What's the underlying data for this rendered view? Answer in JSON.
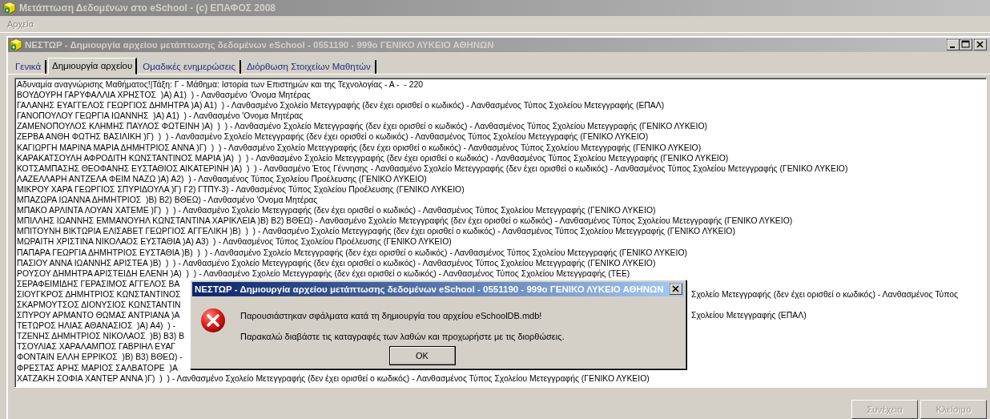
{
  "app": {
    "title": "Μετάπτωση Δεδομένων στο eSchool - (c) ΕΠΑΦΟΣ 2008",
    "menu": [
      {
        "label": "Αρχεία",
        "disabled": true
      }
    ]
  },
  "window": {
    "title": "ΝΕΣΤΩΡ - Δημιουργία αρχείου μετάπτωσης δεδομένων eSchool - 0551190 - 999ο ΓΕΝΙΚΟ ΛΥΚΕΙΟ ΑΘΗΝΩΝ"
  },
  "tabs": [
    {
      "label": "Γενικά",
      "selected": false
    },
    {
      "label": "Δημιουργία αρχείου",
      "selected": true
    },
    {
      "label": "Ομαδικές ενημερώσεις",
      "selected": false
    },
    {
      "label": "Διόρθωση Στοιχείων Μαθητών",
      "selected": false
    }
  ],
  "log": [
    {
      "text": "Αδυναμία αναγνώρισης Μαθήματος!|Τάξη: Γ - Μάθημα: Ιστορία των Επιστημών και της Τεχνολογίας - Α -  - 220"
    },
    {
      "text": "ΒΟΥΔΟΥΡΗ ΓΑΡΥΦΑΛΛΙΑ ΧΡΗΣΤΟΣ  )Α) Α1)  ) - Λανθασμένο 'Ονομα Μητέρας"
    },
    {
      "text": "ΓΑΛΑΝΗΣ ΕΥΑΓΓΕΛΟΣ ΓΕΩΡΓΙΟΣ ΔΗΜΗΤΡΑ )Α) Α1)  ) - Λανθασμένο Σχολείο Μετεγγραφής (δεν έχει ορισθεί ο κωδικός) - Λανθασμένος Τύπος Σχολείου Μετεγγραφής (ΕΠΑΛ)"
    },
    {
      "text": "ΓΑΝΟΠΟΥΛΟΥ ΓΕΩΡΓΙΑ ΙΩΑΝΝΗΣ  )Α) Α1)  ) - Λανθασμένο 'Ονομα Μητέρας"
    },
    {
      "text": "ΖΑΜΕΝΟΠΟΥΛΟΣ ΚΛΗΜΗΣ ΠΑΥΛΟΣ ΦΩΤΕΙΝΗ )Α)  )  ) - Λανθασμένο Σχολείο Μετεγγραφής (δεν έχει ορισθεί ο κωδικός) - Λανθασμένος Τύπος Σχολείου Μετεγγραφής (ΓΕΝΙΚΟ ΛΥΚΕΙΟ)"
    },
    {
      "text": "ΖΕΡΒΑ ΑΝΘΗ ΦΩΤΗΣ ΒΑΣΙΛΙΚΗ )Γ)  )  ) - Λανθασμένο Σχολείο Μετεγγραφής (δεν έχει ορισθεί ο κωδικός) - Λανθασμένος Τύπος Σχολείου Μετεγγραφής (ΓΕΝΙΚΟ ΛΥΚΕΙΟ)"
    },
    {
      "text": "ΚΑΓΙΩΡΓΗ ΜΑΡΙΝΑ ΜΑΡΙΑ ΔΗΜΗΤΡΙΟΣ ΑΝΝΑ )Γ)  )  ) - Λανθασμένο Σχολείο Μετεγγραφής (δεν έχει ορισθεί ο κωδικός) - Λανθασμένος Τύπος Σχολείου Μετεγγραφής (ΓΕΝΙΚΟ ΛΥΚΕΙΟ)"
    },
    {
      "text": "ΚΑΡΑΚΑΤΣΟΥΛΗ ΑΦΡΟΔΙΤΗ ΚΩΝΣΤΑΝΤΙΝΟΣ ΜΑΡΙΑ )Α)  )  ) - Λανθασμένο Σχολείο Μετεγγραφής (δεν έχει ορισθεί ο κωδικός) - Λανθασμένος Τύπος Σχολείου Μετεγγραφής (ΓΕΝΙΚΟ ΛΥΚΕΙΟ)"
    },
    {
      "text": "ΚΟΤΣΑΜΠΑΣΗΣ ΘΕΟΦΑΝΗΣ ΕΥΣΤΑΘΙΟΣ ΑΙΚΑΤΕΡΙΝΗ )Α)  )  ) - Λανθασμένο Έτος Γέννησης - Λανθασμένο Σχολείο Μετεγγραφής (δεν έχει ορισθεί ο κωδικός) - Λανθασμένος Τύπος Σχολείου Μετεγγραφής (ΓΕΝΙΚΟ ΛΥΚΕΙΟ)"
    },
    {
      "text": "ΛΑΖΕΛΛΑΡΗ ΑΝΤΖΕΛΑ ΦΕΙΜ ΝΑΖΩ )Α) Α2)  ) - Λανθασμένος Τύπος Σχολείου Προέλευσης (ΓΕΝΙΚΟ ΛΥΚΕΙΟ)"
    },
    {
      "text": "ΜΙΚΡΟΥ ΧΑΡΑ ΓΕΩΡΓΙΟΣ ΣΠΥΡΙΔΟΥΛΑ )Γ) Γ2) ΓΤΠΥ-3) - Λανθασμένος Τύπος Σχολείου Προέλευσης (ΓΕΝΙΚΟ ΛΥΚΕΙΟ)"
    },
    {
      "text": "ΜΠΑΖΩΡΑ ΙΩΑΝΝΑ ΔΗΜΗΤΡΙΟΣ  )Β) Β2) ΒΘΕΩ) - Λανθασμένο 'Ονομα Μητέρας"
    },
    {
      "text": "ΜΠΑΚΟ ΑΡΛΙΝΤΑ ΛΟΥΑΝ ΧΑΤΕΜΕ )Γ)  )  ) - Λανθασμένο Σχολείο Μετεγγραφής (δεν έχει ορισθεί ο κωδικός) - Λανθασμένος Τύπος Σχολείου Μετεγγραφής (ΓΕΝΙΚΟ ΛΥΚΕΙΟ)"
    },
    {
      "text": "ΜΠΙΛΛΗΣ ΙΩΑΝΝΗΣ ΕΜΜΑΝΟΥΗΛ ΚΩΝΣΤΑΝΤΙΝΑ ΧΑΡΙΚΛΕΙΑ )Β) Β2) ΒΘΕΩ) - Λανθασμένο Σχολείο Μετεγγραφής (δεν έχει ορισθεί ο κωδικός) - Λανθασμένος Τύπος Σχολείου Μετεγγραφής (ΓΕΝΙΚΟ ΛΥΚΕΙΟ)"
    },
    {
      "text": "ΜΠΙΤΟΥΝΗ ΒΙΚΤΩΡΙΑ ΕΛΙΣΑΒΕΤ ΓΕΩΡΓΙΟΣ ΑΓΓΕΛΙΚΗ )Β)  )  ) - Λανθασμένο Σχολείο Μετεγγραφής (δεν έχει ορισθεί ο κωδικός) - Λανθασμένος Τύπος Σχολείου Μετεγγραφής (ΓΕΝΙΚΟ ΛΥΚΕΙΟ)"
    },
    {
      "text": "ΜΩΡΑΙΤΗ ΧΡΙΣΤΙΝΑ ΝΙΚΟΛΑΟΣ ΕΥΣΤΑΘΙΑ )Α) Α3)  ) - Λανθασμένος Τύπος Σχολείου Προέλευσης (ΓΕΝΙΚΟ ΛΥΚΕΙΟ)"
    },
    {
      "text": "ΠΑΠΑΡΑ ΓΕΩΡΓΙΑ ΔΗΜΗΤΡΙΟΣ ΕΥΣΤΑΘΙΑ )Β)  )  ) - Λανθασμένο Σχολείο Μετεγγραφής (δεν έχει ορισθεί ο κωδικός) - Λανθασμένος Τύπος Σχολείου Μετεγγραφής (ΓΕΝΙΚΟ ΛΥΚΕΙΟ)"
    },
    {
      "text": "ΠΑΣΙΟΥ ΑΝΝΑ ΙΩΑΝΝΗΣ ΑΡΙΣΤΕΑ )Β)  )  ) - Λανθασμένο Σχολείο Μετεγγραφής (δεν έχει ορισθεί ο κωδικός) - Λανθασμένος Τύπος Σχολείου Μετεγγραφής (ΓΕΝΙΚΟ ΛΥΚΕΙΟ)"
    },
    {
      "text": "ΡΟΥΣΟΥ ΔΗΜΗΤΡΑ ΑΡΙΣΤΕΙΔΗ ΕΛΕΝΗ )Α)  )  ) - Λανθασμένο Σχολείο Μετεγγραφής (δεν έχει ορισθεί ο κωδικός) - Λανθασμένος Τύπος Σχολείου Μετεγγραφής (ΤΕΕ)"
    },
    {
      "text": "ΣΕΡΑΦΕΙΜΙΔΗΣ ΓΕΡΑΣΙΜΟΣ ΑΓΓΕΛΟΣ ΒΑ"
    },
    {
      "text": "ΣΙΟΥΓΚΡΟΣ ΔΗΜΗΤΡΙΟΣ ΚΩΝΣΤΑΝΤΙΝΟΣ",
      "tail": "Σχολείο Μετεγγραφής (δεν έχει ορισθεί ο κωδικός) - Λανθασμένος Τύπος"
    },
    {
      "text": "ΣΚΑΡΜΟΥΤΣΟΣ ΔΙΟΝΥΣΙΟΣ ΚΩΝΣΤΑΝΤΙΝ"
    },
    {
      "text": "ΣΠΥΡΟΥ ΑΡΜΑΝΤΟ ΘΩΜΑΣ ΑΝΤΡΙΑΝΑ )Α",
      "tail": "Σχολείου Μετεγγραφής (ΕΠΑΛ)"
    },
    {
      "text": "ΤΕΤΩΡΟΣ ΗΛΙΑΣ ΑΘΑΝΑΣΙΟΣ  )Α) Α4)  ) -"
    },
    {
      "text": "ΤΖΕΝΗΣ ΔΗΜΗΤΡΙΟΣ ΝΙΚΟΛΑΟΣ  )Β) Β3) Β"
    },
    {
      "text": "ΤΣΟΥΛΙΑΣ ΧΑΡΑΛΑΜΠΟΣ ΓΑΒΡΙΗΛ ΕΥΑΓ"
    },
    {
      "text": "ΦΟΝΤΑΙΝ ΕΛΛΗ ΕΡΡΙΚΟΣ  )Β) Β3) ΒΘΕΩ) -"
    },
    {
      "text": "ΦΡΕΣΤΑΣ ΑΡΗΣ ΜΑΡΙΟΣ ΣΑΛΒΑΤΟΡΕ  )Α"
    },
    {
      "text": "ΧΑΤΖΑΚΗ ΣΟΦΙΑ ΧΑΝΤΕΡ ΑΝΝΑ )Γ)  )  ) - Λανθασμένο Σχολείο Μετεγγραφής (δεν έχει ορισθεί ο κωδικός) - Λανθασμένος Τύπος Σχολείου Μετεγγραφής (ΓΕΝΙΚΟ ΛΥΚΕΙΟ)"
    }
  ],
  "buttons": [
    {
      "label": "Συνέχεια",
      "disabled": true
    },
    {
      "label": "Κλείσιμο",
      "disabled": true
    }
  ],
  "dialog": {
    "title": "ΝΕΣΤΩΡ - Δημιουργία αρχείου μετάπτωσης δεδομένων eSchool - 0551190 - 999ο ΓΕΝΙΚΟ ΛΥΚΕΙΟ ΑΘΗΝΩΝ",
    "messages": [
      "Παρουσιάστηκαν σφάλματα κατά τη δημιουργία του αρχείου eSchoolDB.mdb!",
      "Παρακαλώ διαβάστε τις καταγραφές των λαθών και προχωρήστε με τις διορθώσεις."
    ],
    "button": "OK"
  }
}
